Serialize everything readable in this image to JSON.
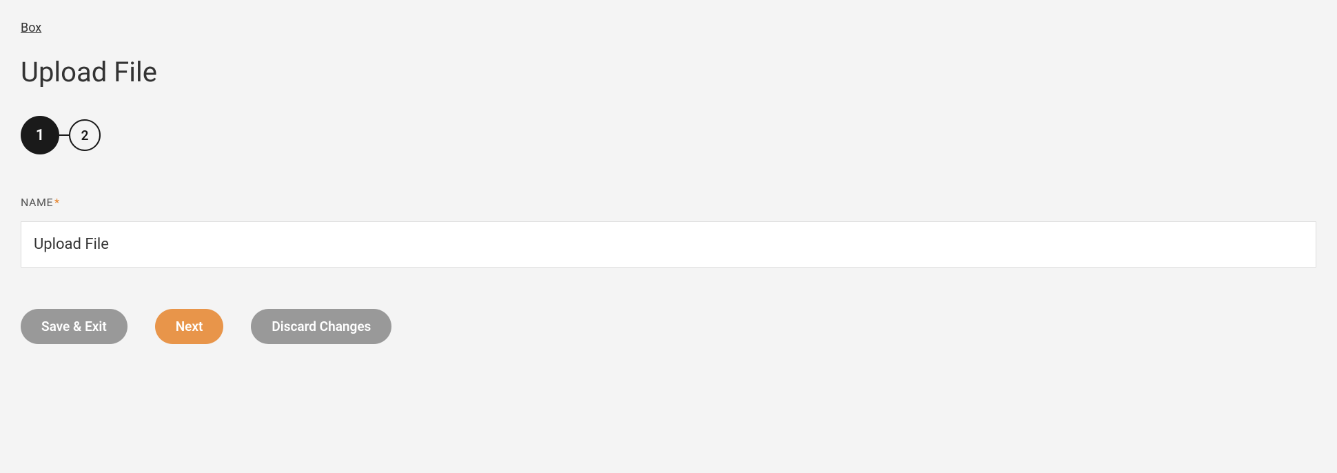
{
  "breadcrumb": {
    "label": "Box"
  },
  "page": {
    "title": "Upload File"
  },
  "stepper": {
    "step1": "1",
    "step2": "2"
  },
  "form": {
    "name_label": "NAME",
    "required_marker": "*",
    "name_value": "Upload File"
  },
  "buttons": {
    "save_exit": "Save & Exit",
    "next": "Next",
    "discard": "Discard Changes"
  }
}
